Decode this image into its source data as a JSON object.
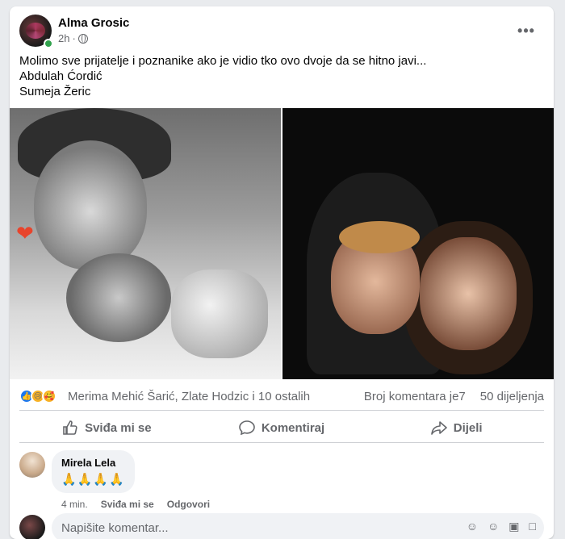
{
  "post": {
    "author": "Alma Grosic",
    "time": "2h",
    "separator": "·",
    "more_label": "•••",
    "text_lines": [
      "Molimo sve prijatelje i poznanike ako je vidio tko ovo dvoje da se hitno javi...",
      "Abdulah Ćordić",
      "Sumeja Žeric"
    ]
  },
  "stats": {
    "reactions": [
      "like",
      "sad",
      "care"
    ],
    "reactors": "Merima Mehić Šarić, Zlate Hodzic i 10 ostalih",
    "comments": "Broj komentara je7",
    "shares": "50 dijeljenja"
  },
  "actions": {
    "like": "Sviđa mi se",
    "comment": "Komentiraj",
    "share": "Dijeli"
  },
  "comment": {
    "name": "Mirela Lela",
    "text": "🙏🙏🙏🙏",
    "time": "4 min.",
    "like": "Sviđa mi se",
    "reply": "Odgovori"
  },
  "composer": {
    "placeholder": "Napišite komentar..."
  },
  "colors": {
    "accent": "#1877f2",
    "muted": "#65676b",
    "online": "#31a24c"
  }
}
